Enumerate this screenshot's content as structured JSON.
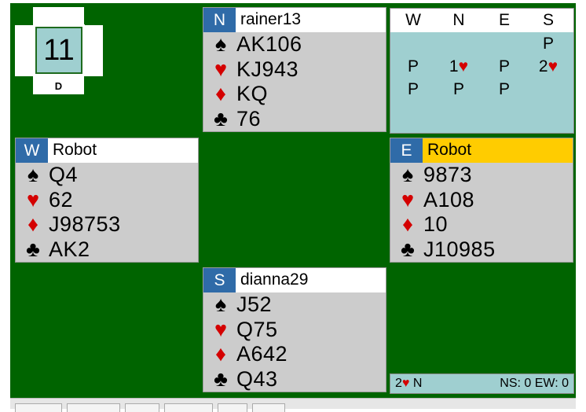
{
  "board": {
    "number": "11",
    "dealer_label": "D"
  },
  "hands": {
    "north": {
      "seat": "N",
      "player": "rainer13",
      "spades": "AK106",
      "hearts": "KJ943",
      "diamonds": "KQ",
      "clubs": "76"
    },
    "west": {
      "seat": "W",
      "player": "Robot",
      "spades": "Q4",
      "hearts": "62",
      "diamonds": "J98753",
      "clubs": "AK2"
    },
    "east": {
      "seat": "E",
      "player": "Robot",
      "spades": "9873",
      "hearts": "A108",
      "diamonds": "10",
      "clubs": "J10985"
    },
    "south": {
      "seat": "S",
      "player": "dianna29",
      "spades": "J52",
      "hearts": "Q75",
      "diamonds": "A642",
      "clubs": "Q43"
    }
  },
  "suit_icons": {
    "spades": "♠",
    "hearts": "♥",
    "diamonds": "♦",
    "clubs": "♣"
  },
  "bidding": {
    "headers": [
      "W",
      "N",
      "E",
      "S"
    ],
    "rows": [
      [
        "",
        "",
        "",
        "P"
      ],
      [
        "P",
        "1♥",
        "P",
        "2♥"
      ],
      [
        "P",
        "P",
        "P",
        ""
      ]
    ]
  },
  "result": {
    "contract_level": "2",
    "contract_suit": "♥",
    "declarer": "N",
    "score": "NS: 0 EW: 0"
  },
  "colors": {
    "table_felt": "#006400",
    "seat_badge": "#2f6ba8",
    "active_seat": "#ffcc00",
    "panel": "#9fcfd0",
    "red_suit": "#d40000"
  }
}
